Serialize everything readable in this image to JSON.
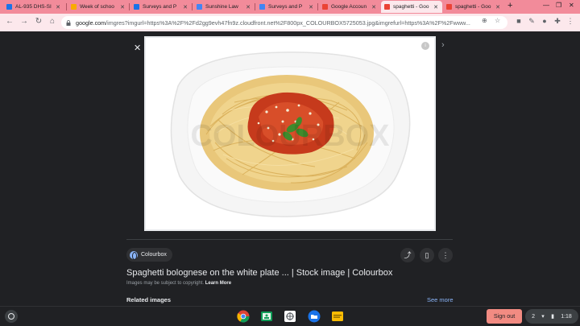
{
  "tabs": [
    {
      "title": "AL-935 DHS-SI",
      "favicon_color": "#1a73e8",
      "active": false
    },
    {
      "title": "Week of schoo",
      "favicon_color": "#f9ab00",
      "active": false
    },
    {
      "title": "Surveys and P",
      "favicon_color": "#1a73e8",
      "active": false
    },
    {
      "title": "Sunshine Law",
      "favicon_color": "#4285f4",
      "active": false
    },
    {
      "title": "Surveys and P",
      "favicon_color": "#4285f4",
      "active": false
    },
    {
      "title": "Google Accoun",
      "favicon_color": "#ea4335",
      "active": false
    },
    {
      "title": "spaghetti - Goo",
      "favicon_color": "#ea4335",
      "active": true
    },
    {
      "title": "spaghetti - Goo",
      "favicon_color": "#ea4335",
      "active": false
    }
  ],
  "omnibox": {
    "host": "google.com",
    "path": "/imgres?imgurl=https%3A%2F%2Fd2gg9evh47fn9z.cloudfront.net%2F800px_COLOURBOX5725053.jpg&imgrefurl=https%3A%2F%2Fwww..."
  },
  "image": {
    "watermark": "COLOURBOX"
  },
  "source": {
    "name": "Colourbox"
  },
  "result": {
    "title": "Spaghetti bolognese on the white plate ... | Stock image | Colourbox",
    "copyright_note": "Images may be subject to copyright.",
    "learn_more": "Learn More"
  },
  "related": {
    "heading": "Related images",
    "see_more": "See more"
  },
  "shelf": {
    "signout_label": "Sign out",
    "notification_count": "2",
    "time": "1:18"
  },
  "colors": {
    "tabstrip": "#f28b9a",
    "toolbar": "#fce8ec",
    "page_bg": "#202124",
    "link": "#8ab4f8",
    "signout": "#f28b82"
  }
}
